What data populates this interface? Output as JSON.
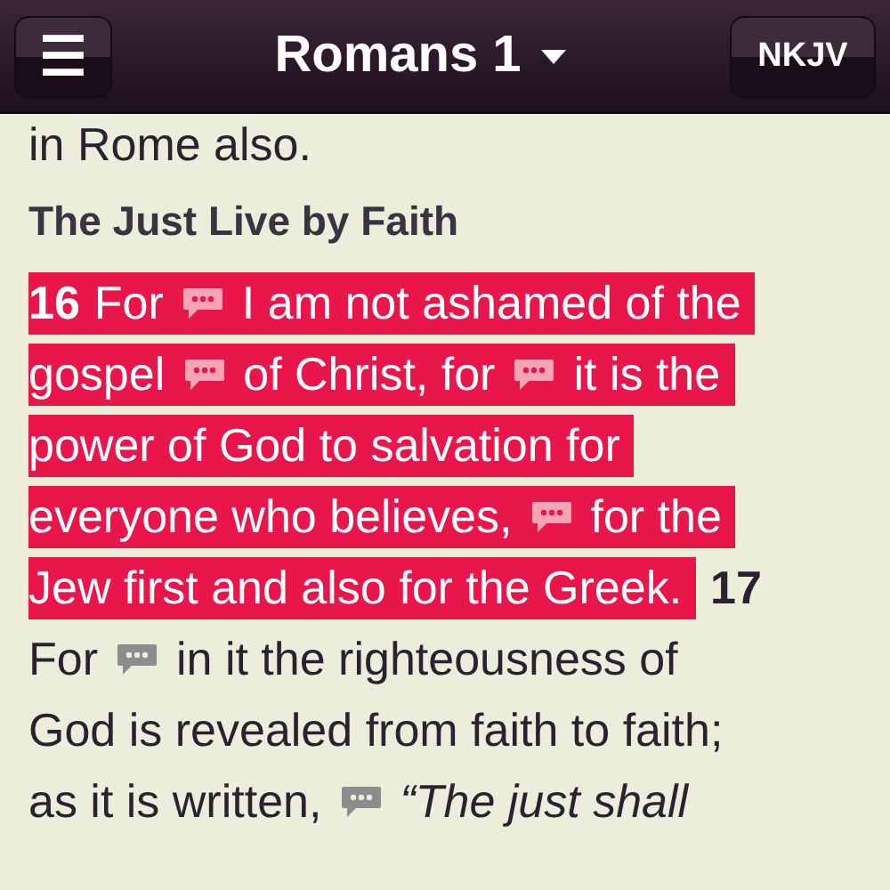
{
  "header": {
    "menu_button": "☰",
    "title": "Romans 1",
    "version_button": "NKJV"
  },
  "content": [
    {
      "kind": "line",
      "segments": [
        {
          "kind": "text",
          "text": "in Rome also.",
          "highlighted": false
        }
      ]
    },
    {
      "kind": "heading",
      "text": "The Just Live by Faith"
    },
    {
      "kind": "line",
      "segments": [
        {
          "kind": "verse",
          "text": "16",
          "highlighted": true
        },
        {
          "kind": "text",
          "text": "For",
          "highlighted": true
        },
        {
          "kind": "note",
          "highlighted": true
        },
        {
          "kind": "text",
          "text": "I am not ashamed of the",
          "highlighted": true
        }
      ]
    },
    {
      "kind": "line",
      "segments": [
        {
          "kind": "text",
          "text": "gospel",
          "highlighted": true
        },
        {
          "kind": "note",
          "highlighted": true
        },
        {
          "kind": "text",
          "text": "of Christ, for",
          "highlighted": true
        },
        {
          "kind": "note",
          "highlighted": true
        },
        {
          "kind": "text",
          "text": "it is the",
          "highlighted": true
        }
      ]
    },
    {
      "kind": "line",
      "segments": [
        {
          "kind": "text",
          "text": "power of God to salvation for",
          "highlighted": true
        }
      ]
    },
    {
      "kind": "line",
      "segments": [
        {
          "kind": "text",
          "text": "everyone who believes,",
          "highlighted": true
        },
        {
          "kind": "note",
          "highlighted": true
        },
        {
          "kind": "text",
          "text": "for the",
          "highlighted": true
        }
      ]
    },
    {
      "kind": "line",
      "segments": [
        {
          "kind": "text",
          "text": "Jew first and also for the Greek.",
          "highlighted": true
        },
        {
          "kind": "verse",
          "text": "17",
          "highlighted": false
        }
      ]
    },
    {
      "kind": "line",
      "segments": [
        {
          "kind": "text",
          "text": "For",
          "highlighted": false
        },
        {
          "kind": "note",
          "highlighted": false
        },
        {
          "kind": "text",
          "text": "in it the righteousness of",
          "highlighted": false
        }
      ]
    },
    {
      "kind": "line",
      "segments": [
        {
          "kind": "text",
          "text": "God is revealed from faith to faith;",
          "highlighted": false
        }
      ]
    },
    {
      "kind": "line",
      "segments": [
        {
          "kind": "text",
          "text": "as it is written,",
          "highlighted": false
        },
        {
          "kind": "note",
          "highlighted": false
        },
        {
          "kind": "quote",
          "text": "“The just shall",
          "highlighted": false
        }
      ]
    }
  ]
}
